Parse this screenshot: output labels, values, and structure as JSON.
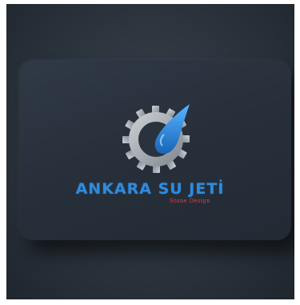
{
  "card": {
    "brand_name": "ANKARA SU JETİ",
    "tagline": "Stone Design"
  },
  "colors": {
    "brand_blue": "#2f8bdc",
    "tagline_red": "#c9464b",
    "card_bg": "#2b333d"
  },
  "icons": [
    "gear-icon",
    "water-drop-icon"
  ]
}
